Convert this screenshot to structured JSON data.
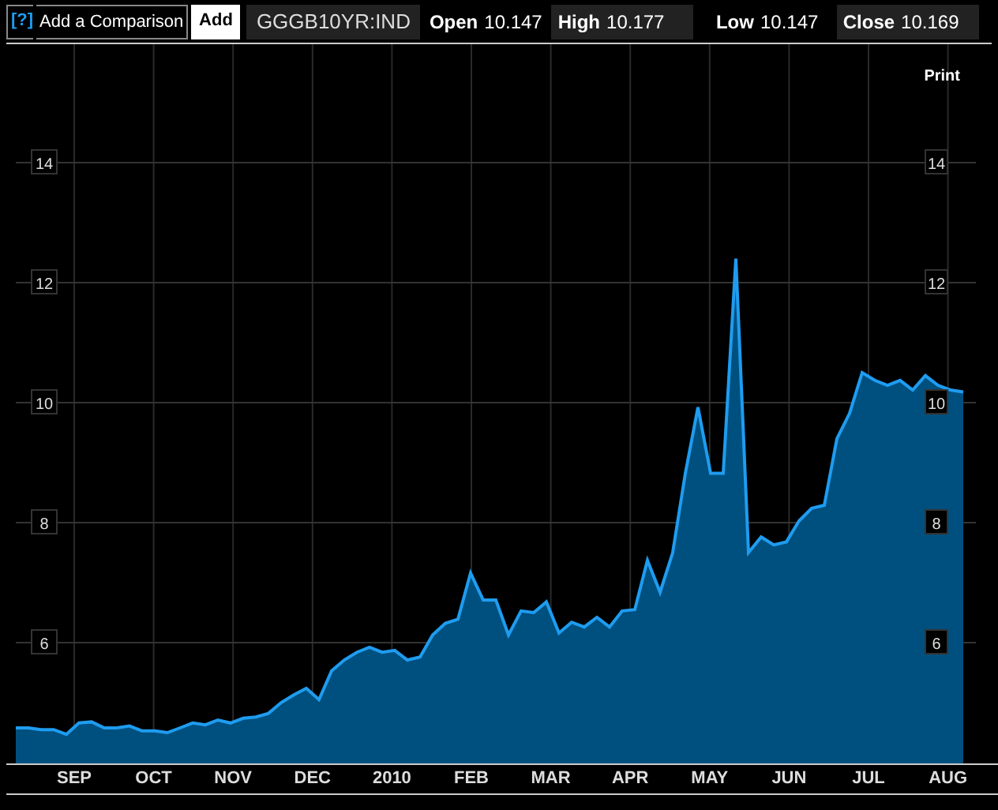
{
  "toolbar": {
    "help": "[?]",
    "comparison": {
      "placeholder": "Add a Comparison"
    },
    "add_button": "Add",
    "ticker": "GGGB10YR:IND",
    "stats": [
      {
        "label": "Open",
        "value": "10.147",
        "boxed": false
      },
      {
        "label": "High",
        "value": "10.177",
        "boxed": true
      },
      {
        "label": "Low",
        "value": "10.147",
        "boxed": false
      },
      {
        "label": "Close",
        "value": "10.169",
        "boxed": true
      }
    ]
  },
  "print_link": "Print",
  "right_axis_labels": [
    "14",
    "12",
    "10",
    "8",
    "6"
  ],
  "x_axis_labels": [
    "SEP",
    "OCT",
    "NOV",
    "DEC",
    "2010",
    "FEB",
    "MAR",
    "APR",
    "MAY",
    "JUN",
    "JUL",
    "AUG"
  ],
  "chart_data": {
    "type": "area",
    "grid": true,
    "ylim": [
      4,
      16
    ],
    "yticks": [
      6,
      8,
      10,
      12,
      14
    ],
    "series": [
      {
        "color": "#1e9cf0",
        "values": [
          4.58,
          4.58,
          4.55,
          4.55,
          4.47,
          4.66,
          4.68,
          4.58,
          4.58,
          4.61,
          4.53,
          4.53,
          4.5,
          4.58,
          4.66,
          4.63,
          4.71,
          4.66,
          4.74,
          4.76,
          4.82,
          5.0,
          5.13,
          5.24,
          5.05,
          5.53,
          5.71,
          5.84,
          5.92,
          5.84,
          5.87,
          5.71,
          5.76,
          6.13,
          6.32,
          6.39,
          7.16,
          6.71,
          6.71,
          6.13,
          6.53,
          6.5,
          6.68,
          6.16,
          6.34,
          6.26,
          6.42,
          6.26,
          6.53,
          6.55,
          7.37,
          6.84,
          7.5,
          8.82,
          9.92,
          8.82,
          8.82,
          12.4,
          7.5,
          7.76,
          7.63,
          7.68,
          8.03,
          8.24,
          8.29,
          9.4,
          9.82,
          10.5,
          10.37,
          10.29,
          10.37,
          10.21,
          10.45,
          10.29,
          10.21,
          10.18
        ]
      }
    ]
  }
}
